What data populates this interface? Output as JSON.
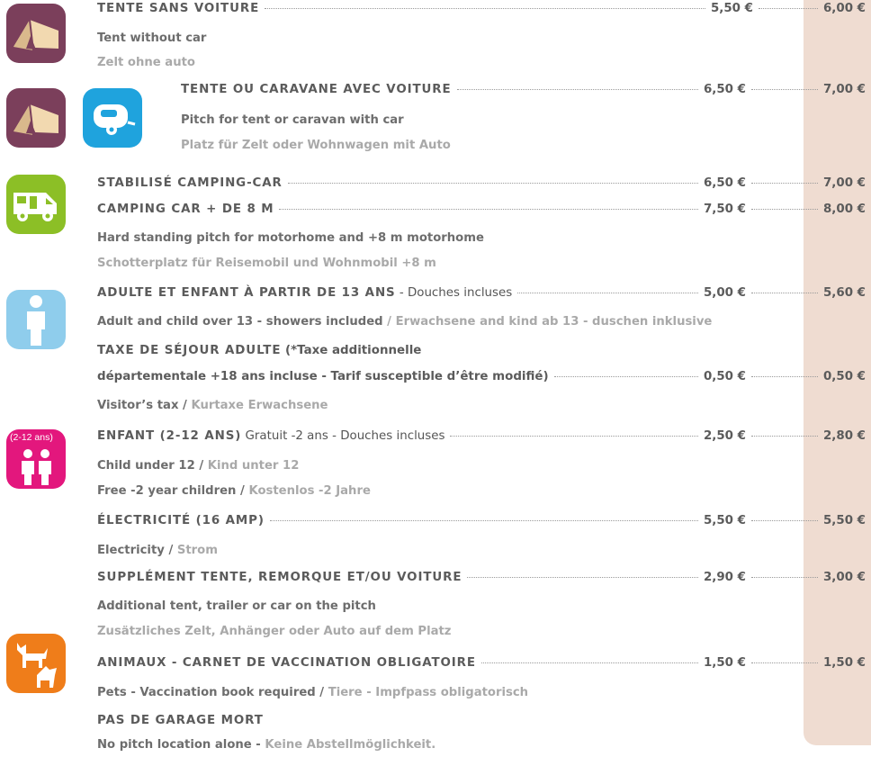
{
  "rows": {
    "tent": {
      "title": "TENTE SANS VOITURE",
      "price1": "5,50 €",
      "price2": "6,00 €",
      "en": "Tent without car",
      "de": "Zelt ohne auto"
    },
    "tentcar": {
      "title": "TENTE OU CARAVANE AVEC VOITURE",
      "price1": "6,50 €",
      "price2": "7,00 €",
      "en": "Pitch for tent or caravan with car",
      "de": "Platz für Zelt oder Wohnwagen mit Auto"
    },
    "camper": {
      "title": "STABILISÉ CAMPING-CAR",
      "price1": "6,50 €",
      "price2": "7,00 €",
      "title_b": "CAMPING CAR + DE 8 M",
      "price1_b": "7,50 €",
      "price2_b": "8,00 €",
      "en": "Hard standing pitch for motorhome and +8 m motorhome",
      "de": "Schotterplatz für Reisemobil und Wohnmobil +8 m"
    },
    "adult": {
      "title": "ADULTE ET ENFANT À PARTIR DE 13 ANS",
      "note": " - Douches incluses",
      "price1": "5,00 €",
      "price2": "5,60 €",
      "en": "Adult and child over 13 - showers included",
      "sep": " / ",
      "de": "Erwachsene and kind ab 13 - duschen inklusive"
    },
    "tax": {
      "title": "TAXE DE SÉJOUR ADULTE",
      "title_note": " (*Taxe additionnelle",
      "line2": "départementale +18 ans incluse - Tarif susceptible d’être modifié)",
      "price1": "0,50 €",
      "price2": "0,50 €",
      "en": "Visitor’s tax",
      "sep": " / ",
      "de": "Kurtaxe Erwachsene"
    },
    "child": {
      "badge": "(2-12 ans)",
      "title": "ENFANT (2-12 ANS)",
      "note": " Gratuit -2 ans - Douches incluses",
      "price1": "2,50 €",
      "price2": "2,80 €",
      "en": "Child under 12",
      "sep": " / ",
      "de": "Kind unter 12",
      "en2": "Free -2 year children",
      "sep2": " / ",
      "de2": "Kostenlos -2 Jahre"
    },
    "elec": {
      "title": "ÉLECTRICITÉ (16 AMP)",
      "price1": "5,50 €",
      "price2": "5,50 €",
      "en": "Electricity",
      "sep": " / ",
      "de": "Strom"
    },
    "extra": {
      "title": "SUPPLÉMENT TENTE, REMORQUE ET/OU VOITURE",
      "price1": "2,90 €",
      "price2": "3,00 €",
      "en": "Additional tent, trailer or car on the pitch",
      "de": "Zusätzliches Zelt, Anhänger oder Auto auf dem Platz"
    },
    "pets": {
      "title": "ANIMAUX - CARNET DE VACCINATION OBLIGATOIRE",
      "price1": "1,50 €",
      "price2": "1,50 €",
      "en": "Pets - Vaccination book required",
      "sep": " / ",
      "de": "Tiere - Impfpass obligatorisch"
    },
    "garage": {
      "title": "PAS DE GARAGE MORT",
      "en": "No pitch location alone - ",
      "de": "Keine Abstellmöglichkeit."
    }
  },
  "colors": {
    "tent_icon": "#7b3f5b",
    "caravan_icon": "#1fa3dd",
    "camper_icon": "#8cbf26",
    "adult_icon": "#8fcdec",
    "child_icon": "#e3177d",
    "pets_icon": "#ef7d1a",
    "high_season_column": "#efdcd1"
  },
  "icons": [
    "tent-icon",
    "tent-icon",
    "caravan-icon",
    "camper-van-icon",
    "adult-person-icon",
    "children-icon",
    "pets-icon"
  ]
}
